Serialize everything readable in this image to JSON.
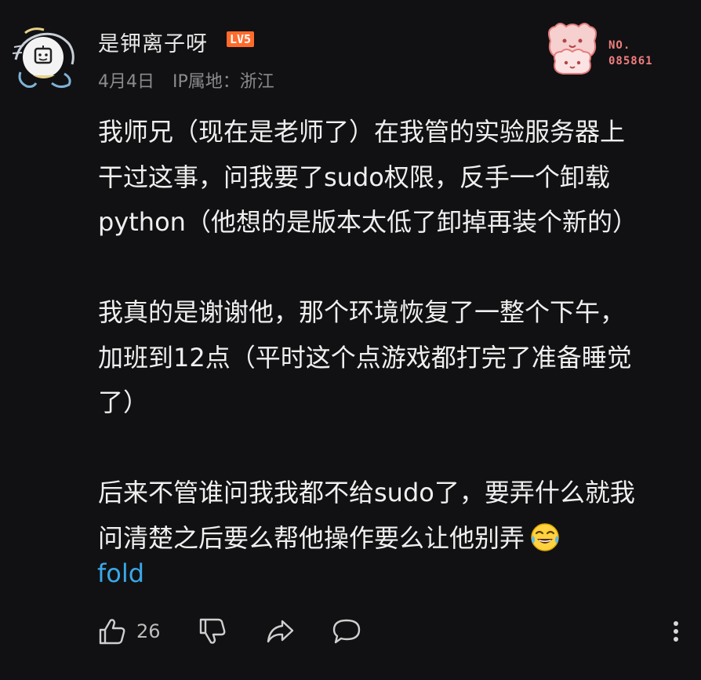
{
  "comment": {
    "username": "是钾离子呀",
    "level": "LV5",
    "date": "4月4日",
    "ip_location": "IP属地：浙江",
    "fan_badge": {
      "prefix": "NO.",
      "number": "085861"
    },
    "paragraphs": [
      [
        "我师兄（现在是老师了）在我管的实验服务器上",
        "干过这事，问我要了sudo权限，反手一个卸载",
        "python（他想的是版本太低了卸掉再装个新的）"
      ],
      [
        "我真的是谢谢他，那个环境恢复了一整个下午，",
        "加班到12点（平时这个点游戏都打完了准备睡觉",
        "了）"
      ],
      [
        "后来不管谁问我我都不给sudo了，要弄什么就我",
        "问清楚之后要么帮他操作要么让他别弄"
      ]
    ],
    "fold_label": "fold",
    "like_count": "26"
  },
  "icons": {
    "avatar": "avatar-icon",
    "emoji": "laughing-crying-emoji-icon",
    "like": "thumbs-up-icon",
    "dislike": "thumbs-down-icon",
    "share": "share-icon",
    "reply": "comment-bubble-icon",
    "more": "more-vertical-icon"
  },
  "colors": {
    "background": "#111113",
    "text": "#efefef",
    "meta": "#8b8b8f",
    "link": "#3aa8e8",
    "level_badge": "#ff6b2c",
    "fan_badge_text": "#f07e7e"
  }
}
